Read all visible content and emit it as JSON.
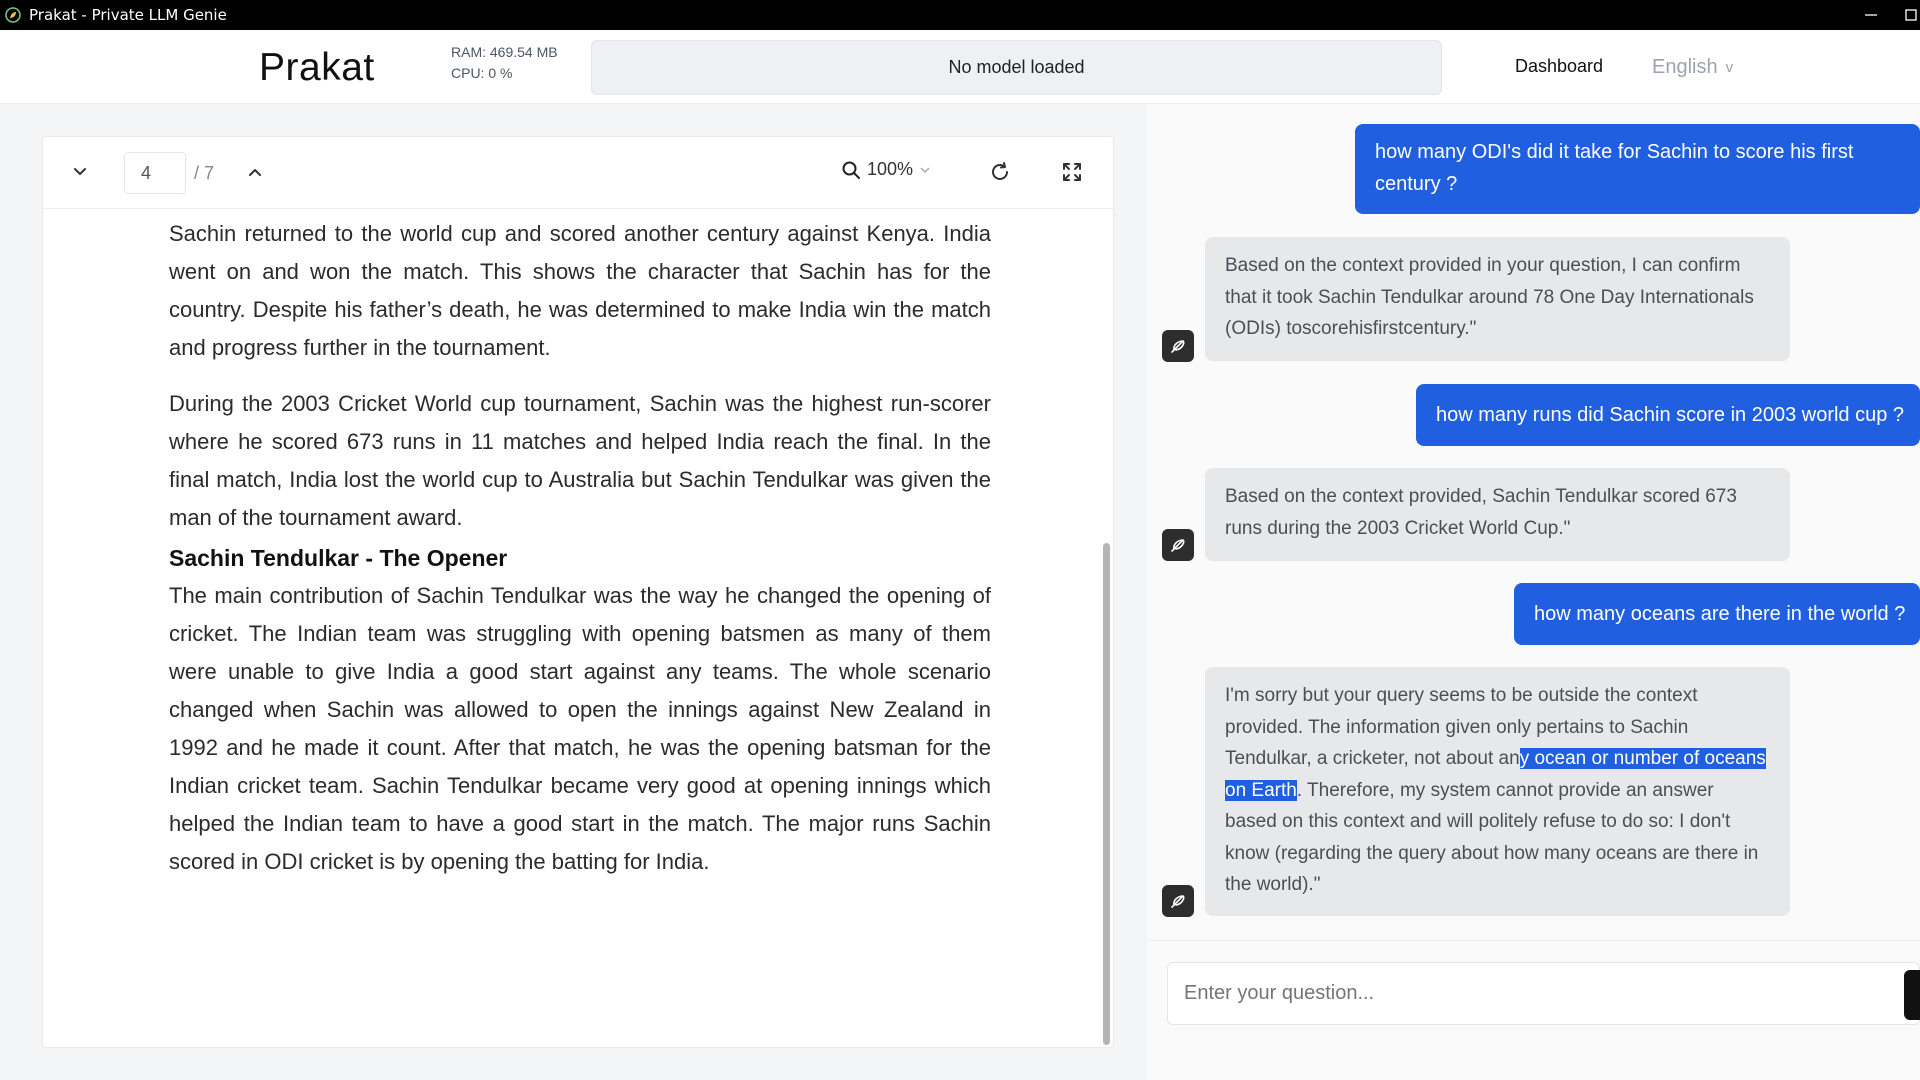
{
  "window": {
    "title": "Prakat - Private LLM Genie",
    "minimize_symbol": "—",
    "icon": "leaf-app-icon"
  },
  "header": {
    "brand": "Prakat",
    "ram": "RAM: 469.54 MB",
    "cpu": "CPU: 0 %",
    "model_status": "No model loaded",
    "nav_dashboard": "Dashboard",
    "language": "English",
    "language_chevron": "v"
  },
  "viewer": {
    "page_current": "4",
    "page_total": "/ 7",
    "zoom": "100%",
    "paragraphs": [
      "Sachin returned to the world cup and scored another century against Kenya. India went on and won the match. This shows the character that Sachin has for the country. Despite his father’s death, he was determined to make India win the match and progress further in the tournament.",
      "During the 2003 Cricket World cup tournament, Sachin was the highest run-scorer where he scored 673 runs in 11 matches and helped India reach the final. In the final match, India lost the world cup to Australia but Sachin Tendulkar was given the man of the tournament award."
    ],
    "heading": "Sachin Tendulkar - The Opener",
    "paragraph_after_heading": "The main contribution of Sachin Tendulkar was the way he changed the opening of cricket. The Indian team was struggling with opening batsmen as many of them were unable to give India a good start against any teams. The whole scenario changed when Sachin was allowed to open the innings against New Zealand in 1992 and he made it count. After that match, he was the opening batsman for the Indian cricket team. Sachin Tendulkar became very good at opening innings which helped the Indian team to have a good start in the match. The major runs Sachin scored in ODI cricket is by opening the batting for India."
  },
  "chat": {
    "messages": [
      {
        "role": "user",
        "text": "how many ODI's did it take for Sachin to score his first century ?"
      },
      {
        "role": "bot",
        "text": "Based on the context provided in your question, I can confirm that it took Sachin Tendulkar around 78 One Day Internationals (ODIs) toscorehisfirstcentury.\""
      },
      {
        "role": "user",
        "text": "how many runs did Sachin score in 2003 world cup ?"
      },
      {
        "role": "bot",
        "text": "Based on the context provided, Sachin Tendulkar scored 673 runs during the 2003 Cricket World Cup.\""
      },
      {
        "role": "user",
        "text": "how many oceans are there in the world ?"
      },
      {
        "role": "bot",
        "text_before": "I'm sorry but your query seems to be outside the context provided. The information given only pertains to Sachin Tendulkar, a cricketer, not about an",
        "text_highlight": "y ocean or number of oceans on Earth",
        "text_after": ". Therefore, my system cannot provide an answer based on this context and will politely refuse to do so: I don't know (regarding the query about how many oceans are there in the world).\""
      }
    ],
    "input_placeholder": "Enter your question..."
  },
  "colors": {
    "accent": "#1f5fe0",
    "bot_bubble": "#e7e8ea",
    "title_bar": "#000000"
  }
}
